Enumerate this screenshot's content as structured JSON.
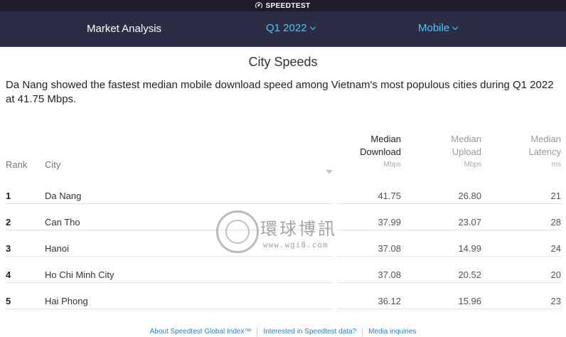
{
  "brand": {
    "name": "SPEEDTEST",
    "icon": "speedometer-icon"
  },
  "nav": {
    "title": "Market Analysis",
    "period": "Q1 2022",
    "type": "Mobile",
    "accent": "#48c6ff",
    "background": "#2c2c44"
  },
  "section": {
    "title": "City Speeds",
    "summary": "Da Nang showed the fastest median mobile download speed among Vietnam's most populous cities during Q1 2022 at 41.75 Mbps."
  },
  "table": {
    "headers": {
      "rank": "Rank",
      "city": "City",
      "download": {
        "line1": "Median",
        "line2": "Download",
        "unit": "Mbps"
      },
      "upload": {
        "line1": "Median",
        "line2": "Upload",
        "unit": "Mbps"
      },
      "latency": {
        "line1": "Median",
        "line2": "Latency",
        "unit": "ms"
      }
    },
    "rows": [
      {
        "rank": "1",
        "city": "Da Nang",
        "download": "41.75",
        "upload": "26.80",
        "latency": "21"
      },
      {
        "rank": "2",
        "city": "Can Tho",
        "download": "37.99",
        "upload": "23.07",
        "latency": "28"
      },
      {
        "rank": "3",
        "city": "Hanoi",
        "download": "37.08",
        "upload": "14.99",
        "latency": "24"
      },
      {
        "rank": "4",
        "city": "Ho Chi Minh City",
        "download": "37.08",
        "upload": "20.52",
        "latency": "20"
      },
      {
        "rank": "5",
        "city": "Hai Phong",
        "download": "36.12",
        "upload": "15.96",
        "latency": "23"
      }
    ]
  },
  "footer": {
    "links": [
      "About Speedtest Global Index™",
      "Interested in Speedtest data?",
      "Media inquiries"
    ]
  },
  "watermark": {
    "text": "環球博訊",
    "url": "www.wgi8.com"
  }
}
